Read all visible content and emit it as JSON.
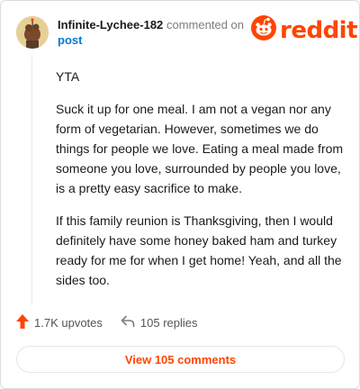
{
  "comment": {
    "username": "Infinite-Lychee-182",
    "commented_on_text": "commented on",
    "post_link_label": "post",
    "avatar_icon": "avatar-icon",
    "paragraphs": [
      "YTA",
      "Suck it up for one meal. I am not a vegan nor any form of vegetarian. However, sometimes we do things for people we love. Eating a meal made from someone you love, surrounded by people you love, is a pretty easy sacrifice to make.",
      "If this family reunion is Thanksgiving, then I would definitely have some honey baked ham and turkey ready for me for when I get home! Yeah, and all the sides too."
    ]
  },
  "brand": {
    "name": "reddit",
    "icon": "reddit-snoo-icon",
    "color": "#ff4500"
  },
  "actions": {
    "upvotes": "1.7K upvotes",
    "replies": "105 replies",
    "upvote_icon": "upvote-arrow-icon",
    "reply_icon": "reply-arrow-icon"
  },
  "view_comments_label": "View 105 comments",
  "colors": {
    "accent": "#ff4500",
    "link": "#0079d3",
    "muted": "#7c7c7c"
  }
}
